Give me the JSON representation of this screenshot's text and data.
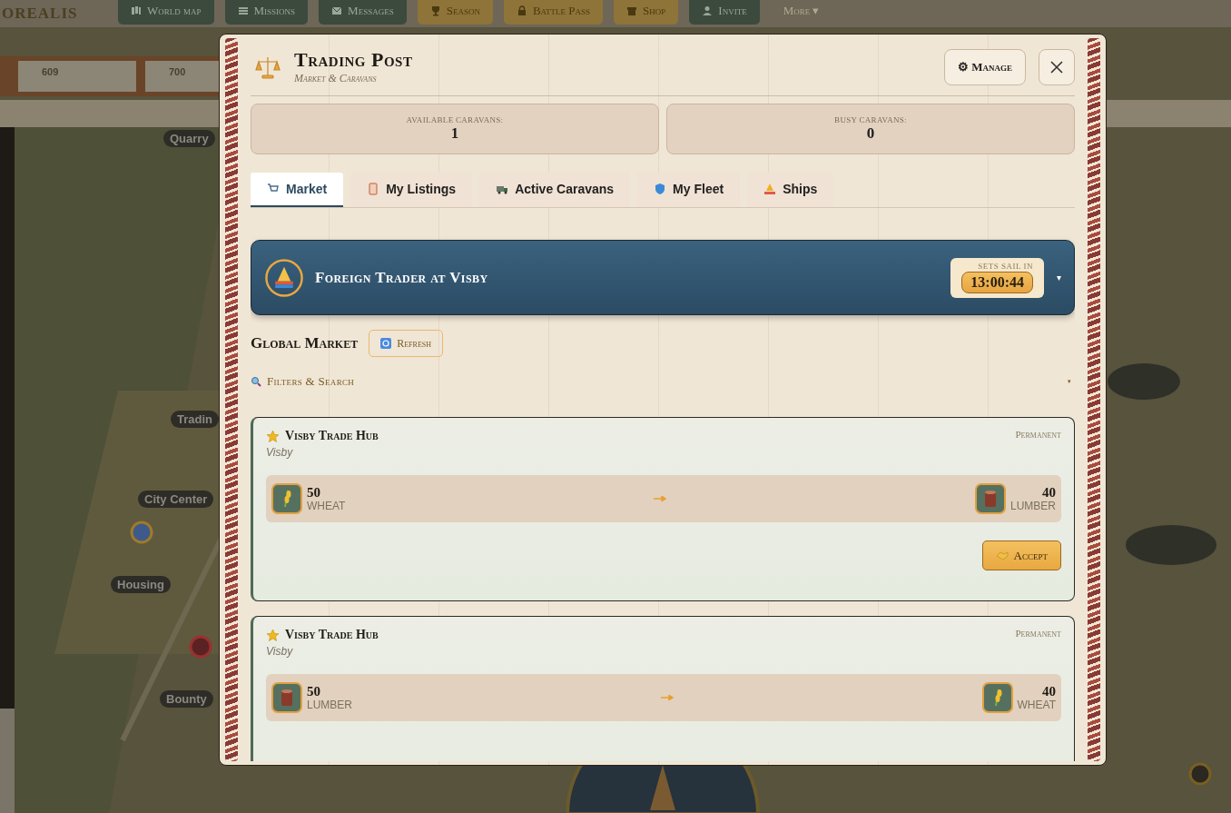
{
  "top_nav": {
    "logo": "OREALIS",
    "items": [
      {
        "label": "World map",
        "kind": "green"
      },
      {
        "label": "Missions",
        "kind": "green"
      },
      {
        "label": "Messages",
        "kind": "green"
      },
      {
        "label": "Season",
        "kind": "gold"
      },
      {
        "label": "Battle Pass",
        "kind": "gold"
      },
      {
        "label": "Shop",
        "kind": "gold"
      },
      {
        "label": "Invite",
        "kind": "green"
      },
      {
        "label": "More ▾",
        "kind": "plain"
      }
    ]
  },
  "resources": [
    {
      "value": "609"
    },
    {
      "value": "700"
    }
  ],
  "map_labels": [
    {
      "label": "Quarry"
    },
    {
      "label": "Tradin"
    },
    {
      "label": "City Center"
    },
    {
      "label": "Housing"
    },
    {
      "label": "Bounty"
    }
  ],
  "modal": {
    "title": "Trading Post",
    "subtitle": "Market & Caravans",
    "manage": "⚙ Manage",
    "stats": [
      {
        "label": "AVAILABLE CARAVANS:",
        "value": "1"
      },
      {
        "label": "BUSY CARAVANS:",
        "value": "0"
      }
    ],
    "tabs": [
      {
        "label": "Market",
        "selected": true
      },
      {
        "label": "My Listings",
        "selected": false
      },
      {
        "label": "Active Caravans",
        "selected": false
      },
      {
        "label": "My Fleet",
        "selected": false
      },
      {
        "label": "Ships",
        "selected": false
      }
    ],
    "banner": {
      "title": "Foreign Trader at Visby",
      "timer_label": "SETS SAIL IN",
      "timer": "13:00:44",
      "caret": "▾"
    },
    "section": {
      "title": "Global Market",
      "refresh": "Refresh",
      "filters": "Filters & Search",
      "filters_caret": "▾"
    },
    "offers": [
      {
        "hub": "Visby Trade Hub",
        "city": "Visby",
        "type": "Permanent",
        "give": {
          "amount": "50",
          "resource": "WHEAT",
          "kind": "wheat"
        },
        "get": {
          "amount": "40",
          "resource": "LUMBER",
          "kind": "lumber"
        },
        "accept": "Accept"
      },
      {
        "hub": "Visby Trade Hub",
        "city": "Visby",
        "type": "Permanent",
        "give": {
          "amount": "50",
          "resource": "LUMBER",
          "kind": "lumber"
        },
        "get": {
          "amount": "40",
          "resource": "WHEAT",
          "kind": "wheat"
        }
      }
    ]
  }
}
